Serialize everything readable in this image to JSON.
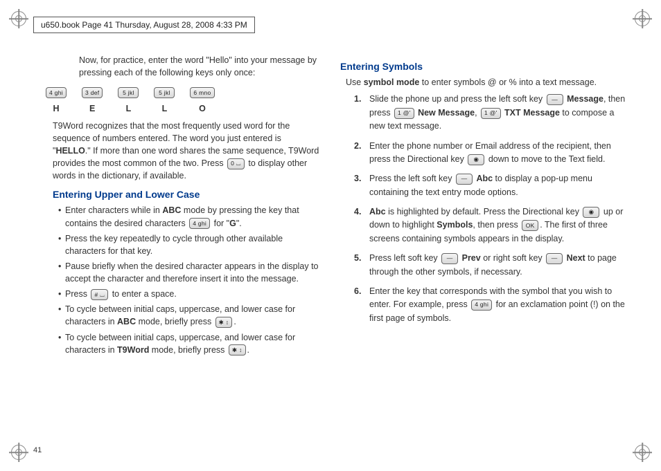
{
  "header": "u650.book  Page 41  Thursday, August 28, 2008  4:33 PM",
  "page_number": "41",
  "left": {
    "practice_intro": "Now, for practice, enter the word \"Hello\" into your message by pressing each of the following keys only once:",
    "hello_keys": [
      {
        "cap": "4 ghi",
        "letter": "H"
      },
      {
        "cap": "3 def",
        "letter": "E"
      },
      {
        "cap": "5 jkl",
        "letter": "L"
      },
      {
        "cap": "5 jkl",
        "letter": "L"
      },
      {
        "cap": "6 mno",
        "letter": "O"
      }
    ],
    "t9_para_a": "T9Word recognizes that the most frequently used word for the sequence of numbers entered. The word you just entered is \"",
    "t9_para_hello": "HELLO",
    "t9_para_b": ".\" If more than one word shares the same sequence, T9Word provides the most common of the two. Press ",
    "t9_key": "0 ⌴",
    "t9_para_c": " to display other words in the dictionary, if available.",
    "upper_lower_title": "Entering Upper and Lower Case",
    "bullets": {
      "b1a": "Enter characters while in ",
      "b1b": "ABC",
      "b1c": " mode by pressing the key that contains the desired characters ",
      "b1key": "4 ghi",
      "b1d": " for \"",
      "b1e": "G",
      "b1f": "\".",
      "b2": "Press the key repeatedly to cycle through other available characters for that key.",
      "b3": "Pause briefly when the desired character appears in the display to accept the character and therefore insert it into the message.",
      "b4a": "Press ",
      "b4key": "# ⌴",
      "b4b": " to enter a space.",
      "b5a": "To cycle between initial caps, uppercase, and lower case for characters in ",
      "b5b": "ABC",
      "b5c": " mode, briefly press ",
      "b5key": "✱ ↕",
      "b5d": ".",
      "b6a": "To cycle between initial caps, uppercase, and lower case for characters in ",
      "b6b": "T9Word",
      "b6c": " mode, briefly press ",
      "b6key": "✱ ↕",
      "b6d": "."
    }
  },
  "right": {
    "symbols_title": "Entering Symbols",
    "intro_a": "Use ",
    "intro_b": "symbol mode",
    "intro_c": " to enter symbols @ or % into a text message.",
    "steps": {
      "s1": {
        "a": "Slide the phone up and press the left soft key ",
        "k1": "—",
        "b": " ",
        "bold1": "Message",
        "c": ", then press ",
        "k2": "1 @'",
        "d": " ",
        "bold2": "New Message",
        "e": ", ",
        "k3": "1 @'",
        "f": " ",
        "bold3": "TXT Message",
        "g": " to compose a new text message."
      },
      "s2": {
        "a": "Enter the phone number or Email address of the recipient, then press the Directional key ",
        "k1": "◉",
        "b": " down to move to the Text field."
      },
      "s3": {
        "a": "Press the left soft key ",
        "k1": "—",
        "b": " ",
        "bold1": "Abc",
        "c": " to display a pop-up menu containing the text entry mode options."
      },
      "s4": {
        "bold1": "Abc",
        "a": " is highlighted by default. Press the Directional key ",
        "k1": "◉",
        "b": " up or down to highlight ",
        "bold2": "Symbols",
        "c": ", then press ",
        "k2": "OK",
        "d": ". The first of three screens containing symbols appears in the display."
      },
      "s5": {
        "a": "Press left soft key ",
        "k1": "—",
        "b": " ",
        "bold1": "Prev",
        "c": " or right soft key ",
        "k2": "—",
        "d": " ",
        "bold2": "Next",
        "e": " to page through the other symbols, if necessary."
      },
      "s6": {
        "a": "Enter the key that corresponds with the symbol that you wish to enter. For example, press ",
        "k1": "4 ghi",
        "b": " for an exclamation point (!) on the first page of symbols."
      }
    },
    "numbers": {
      "n1": "1.",
      "n2": "2.",
      "n3": "3.",
      "n4": "4.",
      "n5": "5.",
      "n6": "6."
    }
  }
}
